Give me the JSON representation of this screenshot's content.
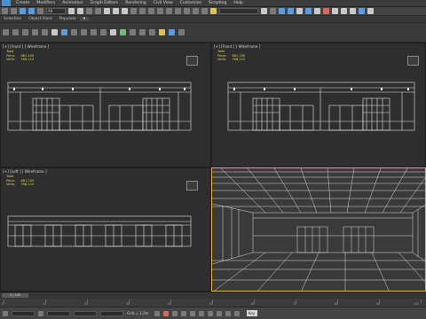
{
  "menu": {
    "items": [
      "Create",
      "Modifiers",
      "Animation",
      "Graph Editors",
      "Rendering",
      "Civil View",
      "Customize",
      "Scripting",
      "Help"
    ]
  },
  "toolbar": {
    "selection_filter": "All",
    "named_selection": ""
  },
  "ribbon": {
    "tabs": [
      "Selection",
      "Object Paint",
      "Populate"
    ]
  },
  "viewports": {
    "top_left": {
      "label": "[+] [Front ] [ Wireframe ]",
      "stats_header": "Total",
      "polys_label": "Polys:",
      "polys": "661,190",
      "verts_label": "Verts:",
      "verts": "766,122"
    },
    "top_right": {
      "label": "[+] [Front ] [ Wireframe ]",
      "stats_header": "Total",
      "polys_label": "Polys:",
      "polys": "661,190",
      "verts_label": "Verts:",
      "verts": "766,122"
    },
    "bottom_left": {
      "label": "[+] [Left ] [ Wireframe ]",
      "stats_header": "Total",
      "polys_label": "Polys:",
      "polys": "661,190",
      "verts_label": "Verts:",
      "verts": "766,122"
    },
    "bottom_right": {
      "label": ""
    }
  },
  "timeline": {
    "frame_slider": "0 / 100",
    "ticks": [
      "0",
      "10",
      "20",
      "30",
      "40",
      "50",
      "60",
      "70",
      "80",
      "90",
      "100"
    ]
  },
  "status": {
    "grid_text": "Grid = 1,0m",
    "auto_key": "Key"
  },
  "colors": {
    "accent_active_viewport": "#e3b53a",
    "stats_text": "#e3d24a"
  }
}
